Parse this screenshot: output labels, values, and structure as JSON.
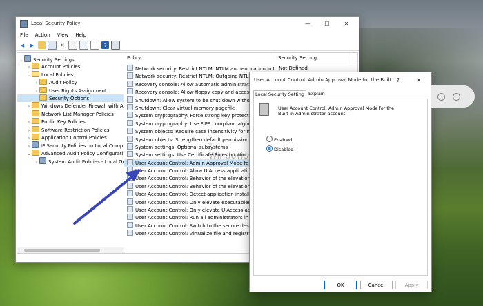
{
  "main_window": {
    "title": "Local Security Policy",
    "menu": [
      "File",
      "Action",
      "View",
      "Help"
    ],
    "tree": [
      {
        "label": "Security Settings",
        "depth": 0,
        "expanded": true,
        "icon": "gear-icon"
      },
      {
        "label": "Account Policies",
        "depth": 1,
        "expanded": false,
        "icon": "folder-icon"
      },
      {
        "label": "Local Policies",
        "depth": 1,
        "expanded": true,
        "icon": "folder-open-icon"
      },
      {
        "label": "Audit Policy",
        "depth": 2,
        "expanded": false,
        "icon": "folder-icon"
      },
      {
        "label": "User Rights Assignment",
        "depth": 2,
        "expanded": false,
        "icon": "folder-icon"
      },
      {
        "label": "Security Options",
        "depth": 2,
        "expanded": null,
        "icon": "folder-icon",
        "selected": true
      },
      {
        "label": "Windows Defender Firewall with Adva",
        "depth": 1,
        "expanded": false,
        "icon": "folder-icon"
      },
      {
        "label": "Network List Manager Policies",
        "depth": 1,
        "expanded": null,
        "icon": "folder-icon"
      },
      {
        "label": "Public Key Policies",
        "depth": 1,
        "expanded": false,
        "icon": "folder-icon"
      },
      {
        "label": "Software Restriction Policies",
        "depth": 1,
        "expanded": false,
        "icon": "folder-icon"
      },
      {
        "label": "Application Control Policies",
        "depth": 1,
        "expanded": false,
        "icon": "folder-icon"
      },
      {
        "label": "IP Security Policies on Local Compute",
        "depth": 1,
        "expanded": false,
        "icon": "gear-icon"
      },
      {
        "label": "Advanced Audit Policy Configuration",
        "depth": 1,
        "expanded": true,
        "icon": "folder-icon"
      },
      {
        "label": "System Audit Policies - Local Grou",
        "depth": 2,
        "expanded": false,
        "icon": "gear-icon"
      }
    ],
    "columns": {
      "policy": "Policy",
      "setting": "Security Setting"
    },
    "rows": [
      {
        "policy": "Network security: Restrict NTLM: NTLM authentication in thi...",
        "setting": "Not Defined"
      },
      {
        "policy": "Network security: Restrict NTLM: Outgoing NTLM traffic to remo...",
        "setting": ""
      },
      {
        "policy": "Recovery console: Allow automatic administrative logon",
        "setting": ""
      },
      {
        "policy": "Recovery console: Allow floppy copy and access to all drives",
        "setting": ""
      },
      {
        "policy": "Shutdown: Allow system to be shut down without having to log on",
        "setting": ""
      },
      {
        "policy": "Shutdown: Clear virtual memory pagefile",
        "setting": ""
      },
      {
        "policy": "System cryptography: Force strong key protection",
        "setting": ""
      },
      {
        "policy": "System cryptography: Use FIPS compliant algorithms",
        "setting": ""
      },
      {
        "policy": "System objects: Require case insensitivity for non-Windows",
        "setting": ""
      },
      {
        "policy": "System objects: Strengthen default permissions of internal",
        "setting": ""
      },
      {
        "policy": "System settings: Optional subsystems",
        "setting": ""
      },
      {
        "policy": "System settings: Use Certificate Rules on Windows",
        "setting": ""
      },
      {
        "policy": "User Account Control: Admin Approval Mode for the Built-in",
        "setting": "",
        "selected": true
      },
      {
        "policy": "User Account Control: Allow UIAccess applications to prompt",
        "setting": ""
      },
      {
        "policy": "User Account Control: Behavior of the elevation prompt for",
        "setting": ""
      },
      {
        "policy": "User Account Control: Behavior of the elevation prompt for",
        "setting": ""
      },
      {
        "policy": "User Account Control: Detect application installations",
        "setting": ""
      },
      {
        "policy": "User Account Control: Only elevate executables that are",
        "setting": ""
      },
      {
        "policy": "User Account Control: Only elevate UIAccess applications",
        "setting": ""
      },
      {
        "policy": "User Account Control: Run all administrators in Admin",
        "setting": ""
      },
      {
        "policy": "User Account Control: Switch to the secure desktop",
        "setting": ""
      },
      {
        "policy": "User Account Control: Virtualize file and registry write",
        "setting": ""
      }
    ]
  },
  "dialog": {
    "title": "User Account Control: Admin Approval Mode for the Built...",
    "help_label": "?",
    "close_label": "✕",
    "tabs": [
      "Local Security Setting",
      "Explain"
    ],
    "active_tab": "Local Security Setting",
    "policy_name": "User Account Control: Admin Approval Mode for the Built-in Administrator account",
    "options": [
      "Enabled",
      "Disabled"
    ],
    "selected_option": "Disabled",
    "buttons": {
      "ok": "OK",
      "cancel": "Cancel",
      "apply": "Apply"
    }
  },
  "watermark": {
    "line1": "The",
    "line2": "WindowsClub"
  },
  "colors": {
    "selection": "#cce4f7",
    "accent": "#0067c0",
    "arrow": "#3a47b8"
  }
}
